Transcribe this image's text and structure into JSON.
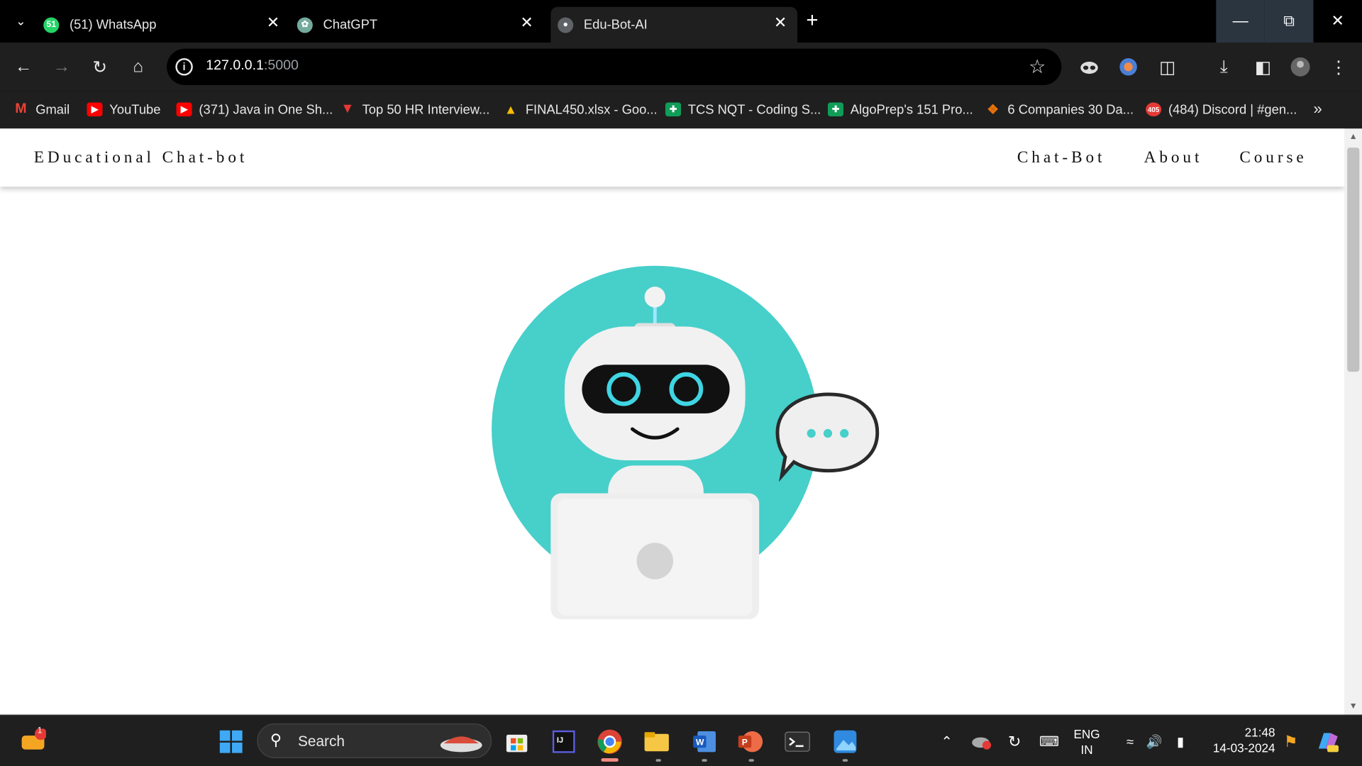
{
  "browser": {
    "tabs": [
      {
        "title": "(51) WhatsApp",
        "badge": "51",
        "color": "#25d366"
      },
      {
        "title": "ChatGPT",
        "color": "#74aa9c"
      },
      {
        "title": "Edu-Bot-AI",
        "color": "#5f6368",
        "active": true
      }
    ],
    "address": {
      "host": "127.0.0.1",
      "port": ":5000"
    },
    "bookmarks": [
      {
        "label": "Gmail",
        "icon": "gmail-icon",
        "color": "#ea4335"
      },
      {
        "label": "YouTube",
        "icon": "youtube-icon",
        "color": "#ff0000"
      },
      {
        "label": "(371) Java in One Sh...",
        "icon": "youtube-icon",
        "color": "#ff0000"
      },
      {
        "label": "Top 50 HR Interview...",
        "icon": "triangle-icon",
        "color": "#e53935"
      },
      {
        "label": "FINAL450.xlsx - Goo...",
        "icon": "drive-icon",
        "color": "#fbbc04"
      },
      {
        "label": "TCS NQT - Coding S...",
        "icon": "sheets-icon",
        "color": "#0f9d58"
      },
      {
        "label": "AlgoPrep's 151 Pro...",
        "icon": "sheets-icon",
        "color": "#0f9d58"
      },
      {
        "label": "6 Companies 30 Da...",
        "icon": "puzzle-icon",
        "color": "#e8710a"
      },
      {
        "label": "(484) Discord | #gen...",
        "icon": "discord-icon",
        "color": "#5865f2",
        "badge": "405"
      }
    ]
  },
  "site": {
    "brand": "EDucational Chat-bot",
    "nav": [
      "Chat-Bot",
      "About",
      "Course"
    ],
    "colors": {
      "teal": "#47cfca",
      "bot": "#eeeeee"
    }
  },
  "taskbar": {
    "search_label": "Search",
    "widget_badge": "1",
    "lang": "ENG",
    "region": "IN",
    "time": "21:48",
    "date": "14-03-2024"
  }
}
